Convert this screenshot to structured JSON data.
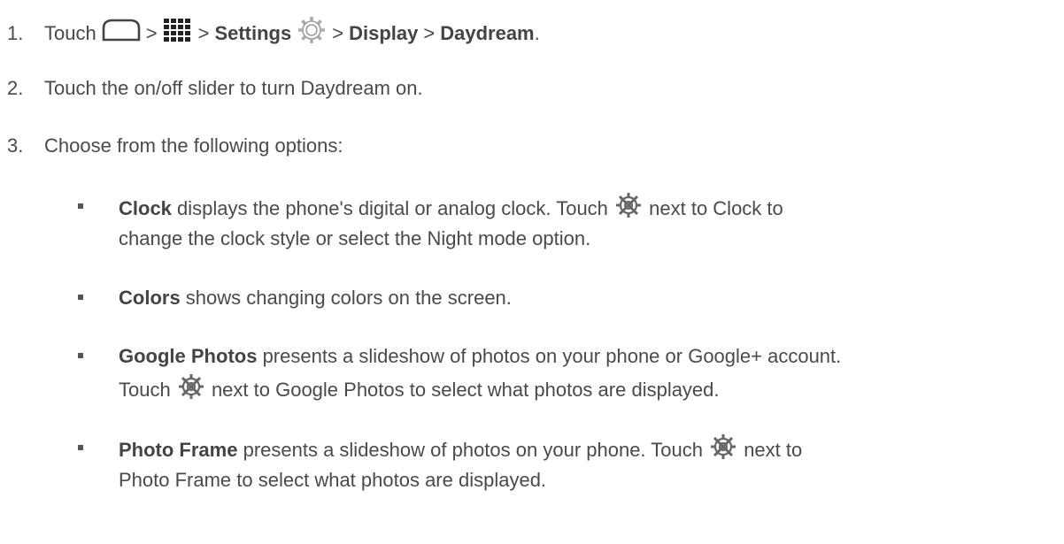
{
  "steps": [
    {
      "number": "1.",
      "touch": "Touch",
      "sep": ">",
      "settings": "Settings",
      "display": "Display",
      "daydream": "Daydream",
      "period": ".",
      "icons": [
        "home-icon",
        "apps-grid-icon",
        "settings-gear-icon"
      ]
    },
    {
      "number": "2.",
      "text": "Touch the on/off slider to turn Daydream on."
    },
    {
      "number": "3.",
      "text": "Choose from the following options:"
    }
  ],
  "options": [
    {
      "name": "Clock",
      "line1_a": " displays the phone's digital or analog clock. Touch ",
      "line1_b": " next to Clock to",
      "line2": "change the clock style or select the Night mode option.",
      "icon": "gear-icon"
    },
    {
      "name": "Colors",
      "line1_a": " shows changing colors on the screen."
    },
    {
      "name": "Google Photos",
      "line1_a": " presents a slideshow of photos on your phone or Google+ account.",
      "line2_a": "Touch ",
      "line2_b": " next to Google Photos to select what photos are displayed.",
      "icon": "gear-icon"
    },
    {
      "name": "Photo Frame",
      "line1_a": " presents a slideshow of photos on your phone. Touch ",
      "line1_b": " next to",
      "line2": "Photo Frame to select what photos are displayed.",
      "icon": "gear-icon"
    }
  ],
  "colors": {
    "text": "#4a4a4a",
    "icon": "#555555"
  }
}
